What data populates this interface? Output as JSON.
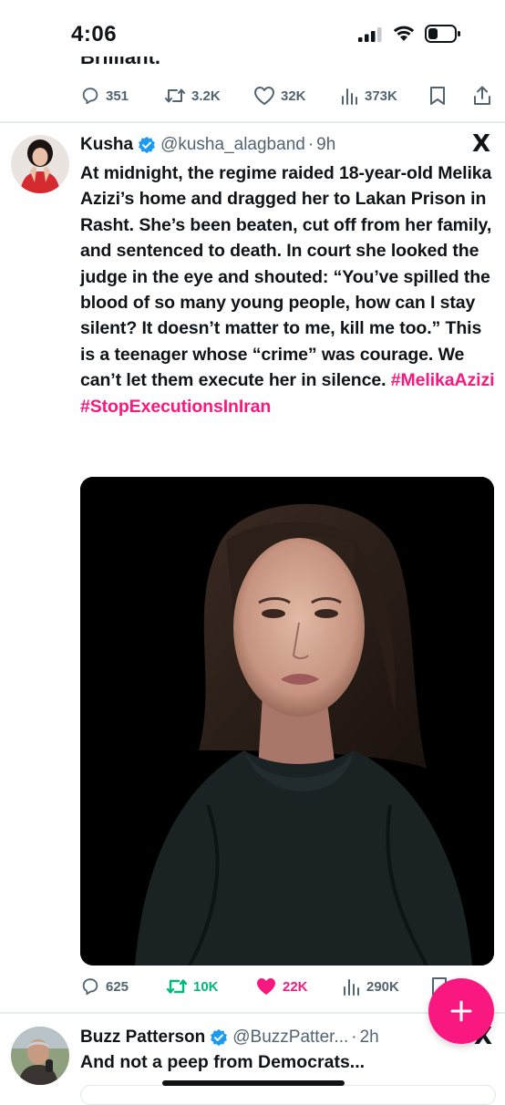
{
  "status_bar": {
    "time": "4:06"
  },
  "previous_tweet": {
    "partial_text": "Brilliant.",
    "replies": "351",
    "reposts": "3.2K",
    "likes": "32K",
    "views": "373K"
  },
  "tweet": {
    "name": "Kusha",
    "handle": "@kusha_alagband",
    "separator": "·",
    "age": "9h",
    "text": "At midnight, the regime raided 18-year-old Melika Azizi’s home and dragged her to Lakan Prison in Rasht. She’s been beaten, cut off from her family, and sentenced to death. In court she looked the judge in the eye and shouted: “You’ve spilled the blood of so many young people, how can I stay silent? It doesn’t matter to me, kill me too.” This is a teenager whose “crime” was courage. We can’t let them execute her in silence.",
    "hashtags": [
      "#MelikaAzizi",
      "#StopExecutionsInIran"
    ],
    "replies": "625",
    "reposts": "10K",
    "likes": "22K",
    "views": "290K",
    "reposted": true,
    "liked": true
  },
  "next_tweet": {
    "name": "Buzz Patterson",
    "handle": "@BuzzPatter...",
    "separator": "·",
    "age": "2h",
    "text": "And not a peep from Democrats..."
  },
  "colors": {
    "accent_pink": "#f91880",
    "repost_green": "#00ba7c",
    "verified_blue": "#1d9bf0",
    "secondary_text": "#536471"
  },
  "icons": {
    "platform_logo": "X",
    "fab": "plus-icon"
  }
}
